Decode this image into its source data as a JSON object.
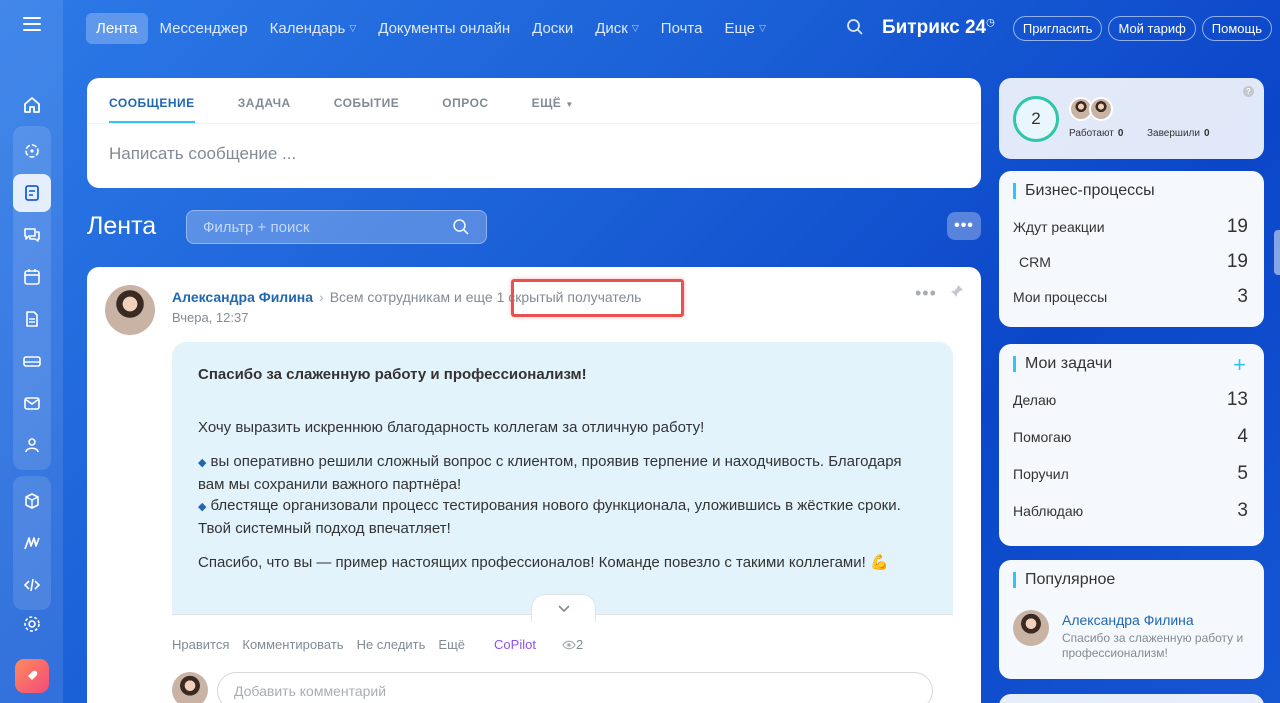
{
  "topnav": {
    "items": [
      {
        "label": "Лента",
        "active": true,
        "dropdown": false
      },
      {
        "label": "Мессенджер",
        "dropdown": false
      },
      {
        "label": "Календарь",
        "dropdown": true
      },
      {
        "label": "Документы онлайн",
        "dropdown": false
      },
      {
        "label": "Доски",
        "dropdown": false
      },
      {
        "label": "Диск",
        "dropdown": true
      },
      {
        "label": "Почта",
        "dropdown": false
      },
      {
        "label": "Еще",
        "dropdown": true
      }
    ],
    "logo": "Битрикс 24",
    "logo_mark": "◷",
    "invite": "Пригласить",
    "tariff": "Мой тариф",
    "help": "Помощь"
  },
  "composer": {
    "tabs": [
      "СООБЩЕНИЕ",
      "ЗАДАЧА",
      "СОБЫТИЕ",
      "ОПРОС",
      "ЕЩЁ"
    ],
    "placeholder": "Написать сообщение ..."
  },
  "feed": {
    "title": "Лента",
    "filter_placeholder": "Фильтр + поиск",
    "more": "•••"
  },
  "post": {
    "author": "Александра Филина",
    "recipients": "Всем сотрудникам  и еще",
    "hidden_recipients": "1 скрытый получатель",
    "time": "Вчера, 12:37",
    "title": "Спасибо за слаженную работу и профессионализм!",
    "intro": "Хочу выразить искреннюю благодарность коллегам за отличную работу!",
    "bullet1": "вы оперативно решили сложный вопрос с клиентом, проявив терпение и находчивость. Благодаря вам мы сохранили важного партнёра!",
    "bullet2": "блестяще организовали процесс тестирования нового функционала, уложившись в жёсткие сроки. Твой системный подход впечатляет!",
    "closing": "Спасибо, что вы — пример настоящих профессионалов! Команде повезло с такими коллегами! 💪",
    "actions": {
      "like": "Нравится",
      "comment": "Комментировать",
      "unfollow": "Не следить",
      "more": "Ещё",
      "copilot": "CoPilot",
      "views": "2"
    },
    "comment_placeholder": "Добавить комментарий"
  },
  "stats_widget": {
    "count": "2",
    "working_label": "Работают",
    "working_value": "0",
    "done_label": "Завершили",
    "done_value": "0",
    "help": "?"
  },
  "bp_widget": {
    "title": "Бизнес-процессы",
    "rows": [
      {
        "label": "Ждут реакции",
        "value": "19"
      },
      {
        "label": "CRM",
        "value": "19"
      },
      {
        "label": "Мои процессы",
        "value": "3"
      }
    ]
  },
  "tasks_widget": {
    "title": "Мои задачи",
    "plus": "+",
    "rows": [
      {
        "label": "Делаю",
        "value": "13"
      },
      {
        "label": "Помогаю",
        "value": "4"
      },
      {
        "label": "Поручил",
        "value": "5"
      },
      {
        "label": "Наблюдаю",
        "value": "3"
      }
    ]
  },
  "popular_widget": {
    "title": "Популярное",
    "author": "Александра Филина",
    "text": "Спасибо за слаженную работу и профессионализм!"
  },
  "colors": {
    "accent": "#2067b0",
    "highlight": "#e8514f",
    "copilot": "#8e52ec"
  }
}
